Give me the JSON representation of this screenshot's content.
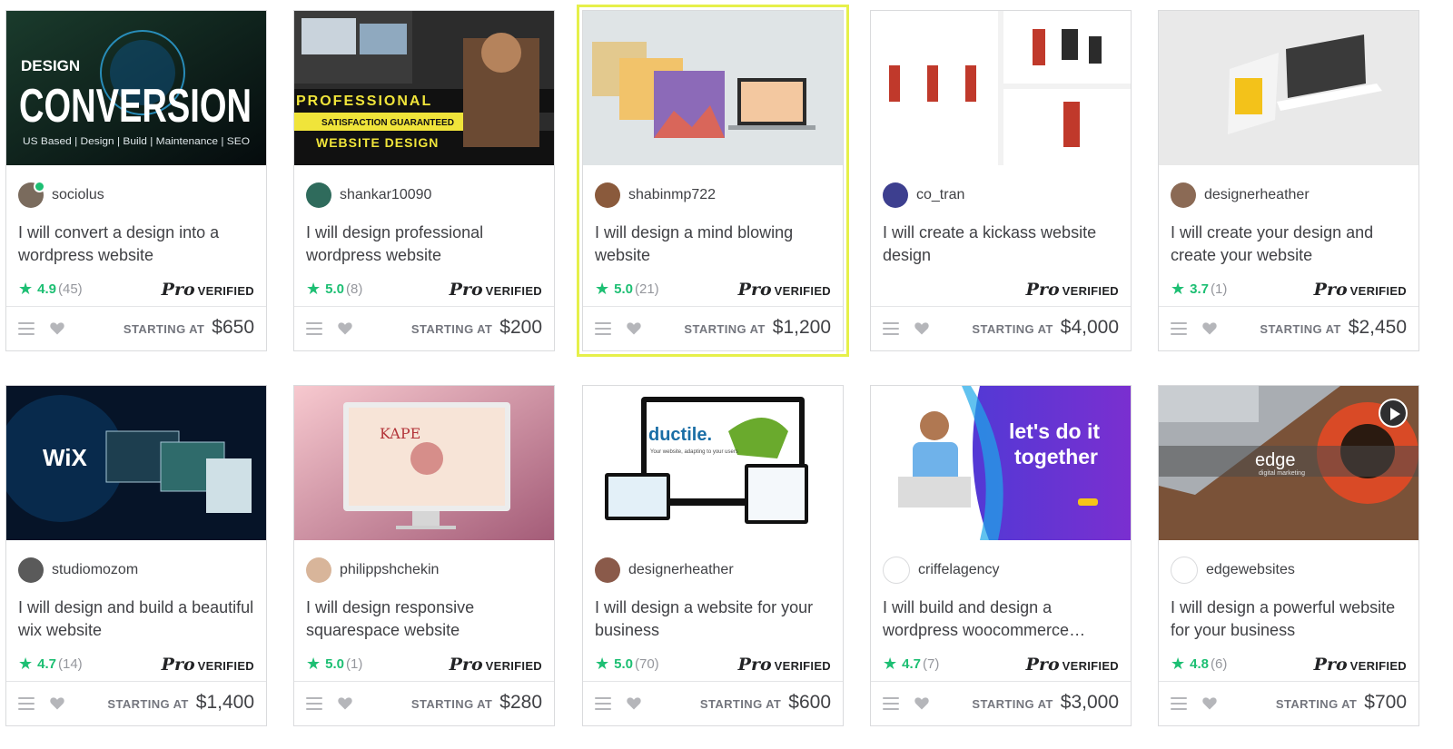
{
  "accent_color": "#1dbf73",
  "focus_color": "#e6f04a",
  "gigs": [
    {
      "seller": "sociolus",
      "title": "I will convert a design into a wordpress website",
      "rating": "4.9",
      "reviews": "(45)",
      "starting_label": "STARTING AT",
      "price": "$650",
      "pro_word": "Pro",
      "pro_verified": "VERIFIED",
      "online": true,
      "thumb": {
        "line1": "DESIGN",
        "line2": "CONVERSION",
        "line3": "US Based | Design | Build | Maintenance | SEO"
      }
    },
    {
      "seller": "shankar10090",
      "title": "I will design professional wordpress website",
      "rating": "5.0",
      "reviews": "(8)",
      "starting_label": "STARTING AT",
      "price": "$200",
      "pro_word": "Pro",
      "pro_verified": "VERIFIED",
      "online": false,
      "thumb": {
        "line1": "PROFESSIONAL",
        "line2": "SATISFACTION GUARANTEED",
        "line3": "WEBSITE DESIGN"
      }
    },
    {
      "seller": "shabinmp722",
      "title": "I will design a mind blowing website",
      "rating": "5.0",
      "reviews": "(21)",
      "starting_label": "STARTING AT",
      "price": "$1,200",
      "pro_word": "Pro",
      "pro_verified": "VERIFIED",
      "online": false,
      "focused": true
    },
    {
      "seller": "co_tran",
      "title": "I will create a kickass website design",
      "rating": "",
      "reviews": "",
      "starting_label": "STARTING AT",
      "price": "$4,000",
      "pro_word": "Pro",
      "pro_verified": "VERIFIED",
      "online": false
    },
    {
      "seller": "designerheather",
      "title": "I will create your design and create your website",
      "rating": "3.7",
      "reviews": "(1)",
      "starting_label": "STARTING AT",
      "price": "$2,450",
      "pro_word": "Pro",
      "pro_verified": "VERIFIED",
      "online": false
    },
    {
      "seller": "studiomozom",
      "title": "I will design and build a beautiful wix website",
      "rating": "4.7",
      "reviews": "(14)",
      "starting_label": "STARTING AT",
      "price": "$1,400",
      "pro_word": "Pro",
      "pro_verified": "VERIFIED",
      "online": false,
      "thumb": {
        "line1": "WiX"
      }
    },
    {
      "seller": "philippshchekin",
      "title": "I will design responsive squarespace website",
      "rating": "5.0",
      "reviews": "(1)",
      "starting_label": "STARTING AT",
      "price": "$280",
      "pro_word": "Pro",
      "pro_verified": "VERIFIED",
      "online": false,
      "thumb": {
        "line1": "KAPE"
      }
    },
    {
      "seller": "designerheather",
      "title": "I will design a website for your business",
      "rating": "5.0",
      "reviews": "(70)",
      "starting_label": "STARTING AT",
      "price": "$600",
      "pro_word": "Pro",
      "pro_verified": "VERIFIED",
      "online": false,
      "thumb": {
        "line1": "ductile.",
        "line2": "Your website, adapting to your users"
      }
    },
    {
      "seller": "criffelagency",
      "title": "I will build and design a wordpress woocommerce website",
      "rating": "4.7",
      "reviews": "(7)",
      "starting_label": "STARTING AT",
      "price": "$3,000",
      "pro_word": "Pro",
      "pro_verified": "VERIFIED",
      "online": false,
      "thumb": {
        "line1": "let's do it",
        "line2": "together"
      }
    },
    {
      "seller": "edgewebsites",
      "title": "I will design a powerful website for your business",
      "rating": "4.8",
      "reviews": "(6)",
      "starting_label": "STARTING AT",
      "price": "$700",
      "pro_word": "Pro",
      "pro_verified": "VERIFIED",
      "online": false,
      "thumb": {
        "line1": "edge",
        "line2": "digital marketing"
      }
    }
  ]
}
